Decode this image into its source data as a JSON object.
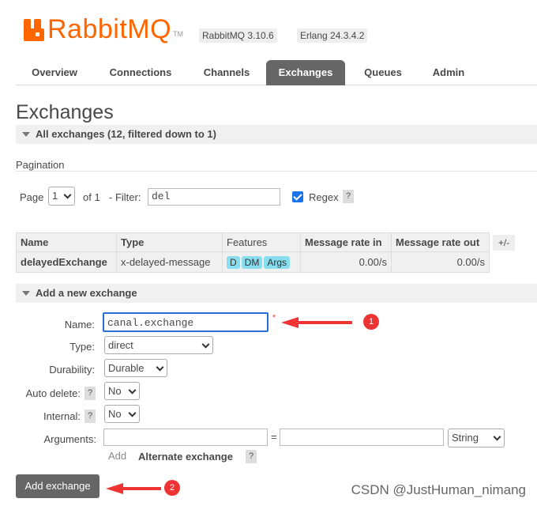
{
  "header": {
    "logo_text": "RabbitMQ",
    "logo_tm": "TM",
    "version": "RabbitMQ 3.10.6",
    "erlang": "Erlang 24.3.4.2",
    "brand_color": "#ff6600"
  },
  "tabs": [
    {
      "label": "Overview"
    },
    {
      "label": "Connections"
    },
    {
      "label": "Channels"
    },
    {
      "label": "Exchanges",
      "active": true
    },
    {
      "label": "Queues"
    },
    {
      "label": "Admin"
    }
  ],
  "page_title": "Exchanges",
  "all_exchanges": {
    "heading": "All exchanges (12, filtered down to 1)",
    "pagination_label": "Pagination",
    "page_label": "Page",
    "page_value": "1",
    "of_label": "of 1",
    "filter_label": "- Filter:",
    "filter_value": "del",
    "regex_label": "Regex",
    "regex_checked": true,
    "help": "?",
    "columns": [
      "Name",
      "Type",
      "Features",
      "Message rate in",
      "Message rate out"
    ],
    "plus_minus": "+/-",
    "rows": [
      {
        "name": "delayedExchange",
        "type": "x-delayed-message",
        "features": [
          "D",
          "DM",
          "Args"
        ],
        "rate_in": "0.00/s",
        "rate_out": "0.00/s"
      }
    ]
  },
  "add_exchange": {
    "heading": "Add a new exchange",
    "name_label": "Name:",
    "name_value": "canal.exchange",
    "required_mark": "*",
    "type_label": "Type:",
    "type_value": "direct",
    "durability_label": "Durability:",
    "durability_value": "Durable",
    "auto_delete_label": "Auto delete:",
    "auto_delete_value": "No",
    "internal_label": "Internal:",
    "internal_value": "No",
    "arguments_label": "Arguments:",
    "equals": "=",
    "arg_type_value": "String",
    "add_label": "Add",
    "alternate_exchange": "Alternate exchange",
    "help": "?",
    "submit_label": "Add exchange"
  },
  "annotations": {
    "marker_1": "1",
    "marker_2": "2",
    "arrow_color": "#e33333"
  },
  "watermark": "CSDN @JustHuman_nimang"
}
